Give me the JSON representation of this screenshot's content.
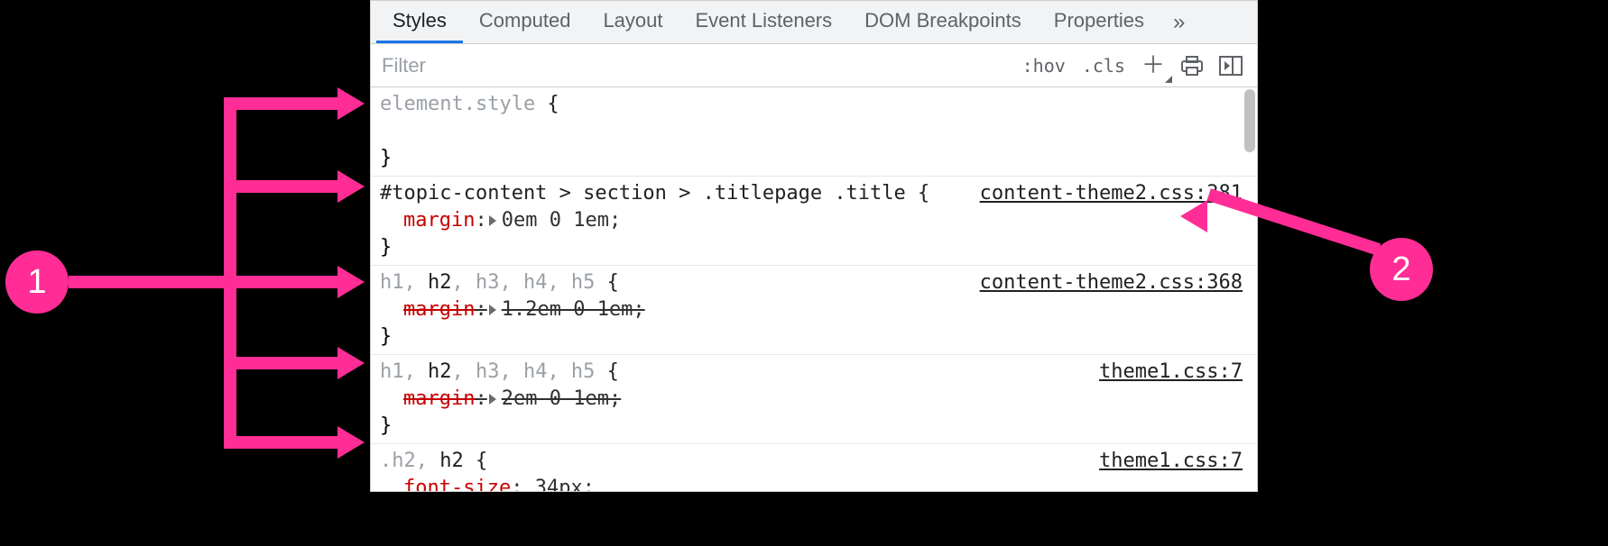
{
  "tabs": {
    "items": [
      "Styles",
      "Computed",
      "Layout",
      "Event Listeners",
      "DOM Breakpoints",
      "Properties"
    ],
    "activeIndex": 0,
    "overflow": "»"
  },
  "filter": {
    "placeholder": "Filter",
    "hov": ":hov",
    "cls": ".cls"
  },
  "rules": [
    {
      "selectorHtml": "<span class='elstyle'>element.style</span> {",
      "props": [],
      "close": "}",
      "link": ""
    },
    {
      "selectorHtml": "#topic-content > section > .titlepage .title {",
      "props": [
        {
          "name": "margin",
          "expand": true,
          "value": "0em 0 1em",
          "struck": false
        }
      ],
      "close": "}",
      "link": "content-theme2.css:381"
    },
    {
      "selectorHtml": "<span class='dim'>h1, </span>h2<span class='dim'>, h3, h4, h5</span> {",
      "props": [
        {
          "name": "margin",
          "expand": true,
          "value": "1.2em 0 1em",
          "struck": true
        }
      ],
      "close": "}",
      "link": "content-theme2.css:368"
    },
    {
      "selectorHtml": "<span class='dim'>h1, </span>h2<span class='dim'>, h3, h4, h5</span> {",
      "props": [
        {
          "name": "margin",
          "expand": true,
          "value": "2em 0 1em",
          "struck": true
        }
      ],
      "close": "}",
      "link": "theme1.css:7"
    },
    {
      "selectorHtml": "<span class='dim'>.h2, </span>h2 {",
      "props": [
        {
          "name": "font-size",
          "expand": false,
          "value": "34px",
          "struck": false
        }
      ],
      "close": "}",
      "link": "theme1.css:7"
    }
  ],
  "annot": {
    "left": "1",
    "right": "2"
  }
}
